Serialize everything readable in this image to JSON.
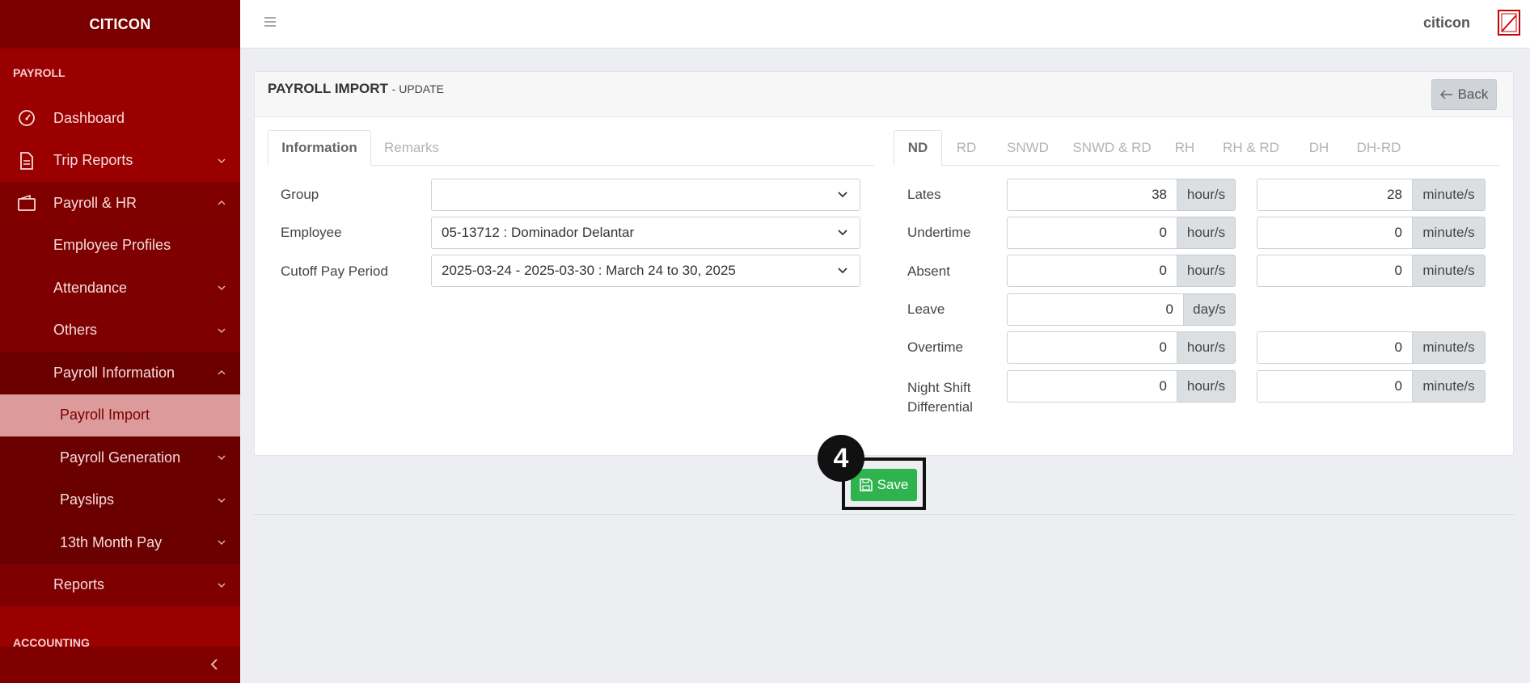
{
  "sidebar": {
    "brand": "CITICON",
    "section_payroll": "PAYROLL",
    "section_accounting": "ACCOUNTING",
    "items": {
      "dashboard": "Dashboard",
      "trip_reports": "Trip Reports",
      "payroll_hr": "Payroll & HR",
      "employee_profiles": "Employee Profiles",
      "attendance": "Attendance",
      "others": "Others",
      "payroll_information": "Payroll Information",
      "payroll_import": "Payroll Import",
      "payroll_generation": "Payroll Generation",
      "payslips": "Payslips",
      "thirteenth_month": "13th Month Pay",
      "reports": "Reports"
    }
  },
  "topbar": {
    "user": "citicon"
  },
  "card": {
    "title": "PAYROLL IMPORT",
    "subtitle": "- UPDATE",
    "back_label": "Back"
  },
  "left_tabs": [
    "Information",
    "Remarks"
  ],
  "right_tabs": [
    "ND",
    "RD",
    "SNWD",
    "SNWD & RD",
    "RH",
    "RH & RD",
    "DH",
    "DH-RD"
  ],
  "info": {
    "group_label": "Group",
    "group_value": "",
    "employee_label": "Employee",
    "employee_value": "05-13712 : Dominador Delantar",
    "cutoff_label": "Cutoff Pay Period",
    "cutoff_value": "2025-03-24 - 2025-03-30 : March 24 to 30, 2025"
  },
  "nd": {
    "lates": {
      "label": "Lates",
      "hours": "38",
      "minutes": "28"
    },
    "undertime": {
      "label": "Undertime",
      "hours": "0",
      "minutes": "0"
    },
    "absent": {
      "label": "Absent",
      "hours": "0",
      "minutes": "0"
    },
    "leave": {
      "label": "Leave",
      "days": "0"
    },
    "overtime": {
      "label": "Overtime",
      "hours": "0",
      "minutes": "0"
    },
    "nsd": {
      "label_line1": "Night Shift",
      "label_line2": "Differential",
      "hours": "0",
      "minutes": "0"
    },
    "unit_hours": "hour/s",
    "unit_minutes": "minute/s",
    "unit_days": "day/s"
  },
  "save_label": "Save",
  "step_badge": "4",
  "colors": {
    "sidebar": "#9b0000",
    "active_item": "#dc9a9a",
    "save": "#2eb34f"
  }
}
